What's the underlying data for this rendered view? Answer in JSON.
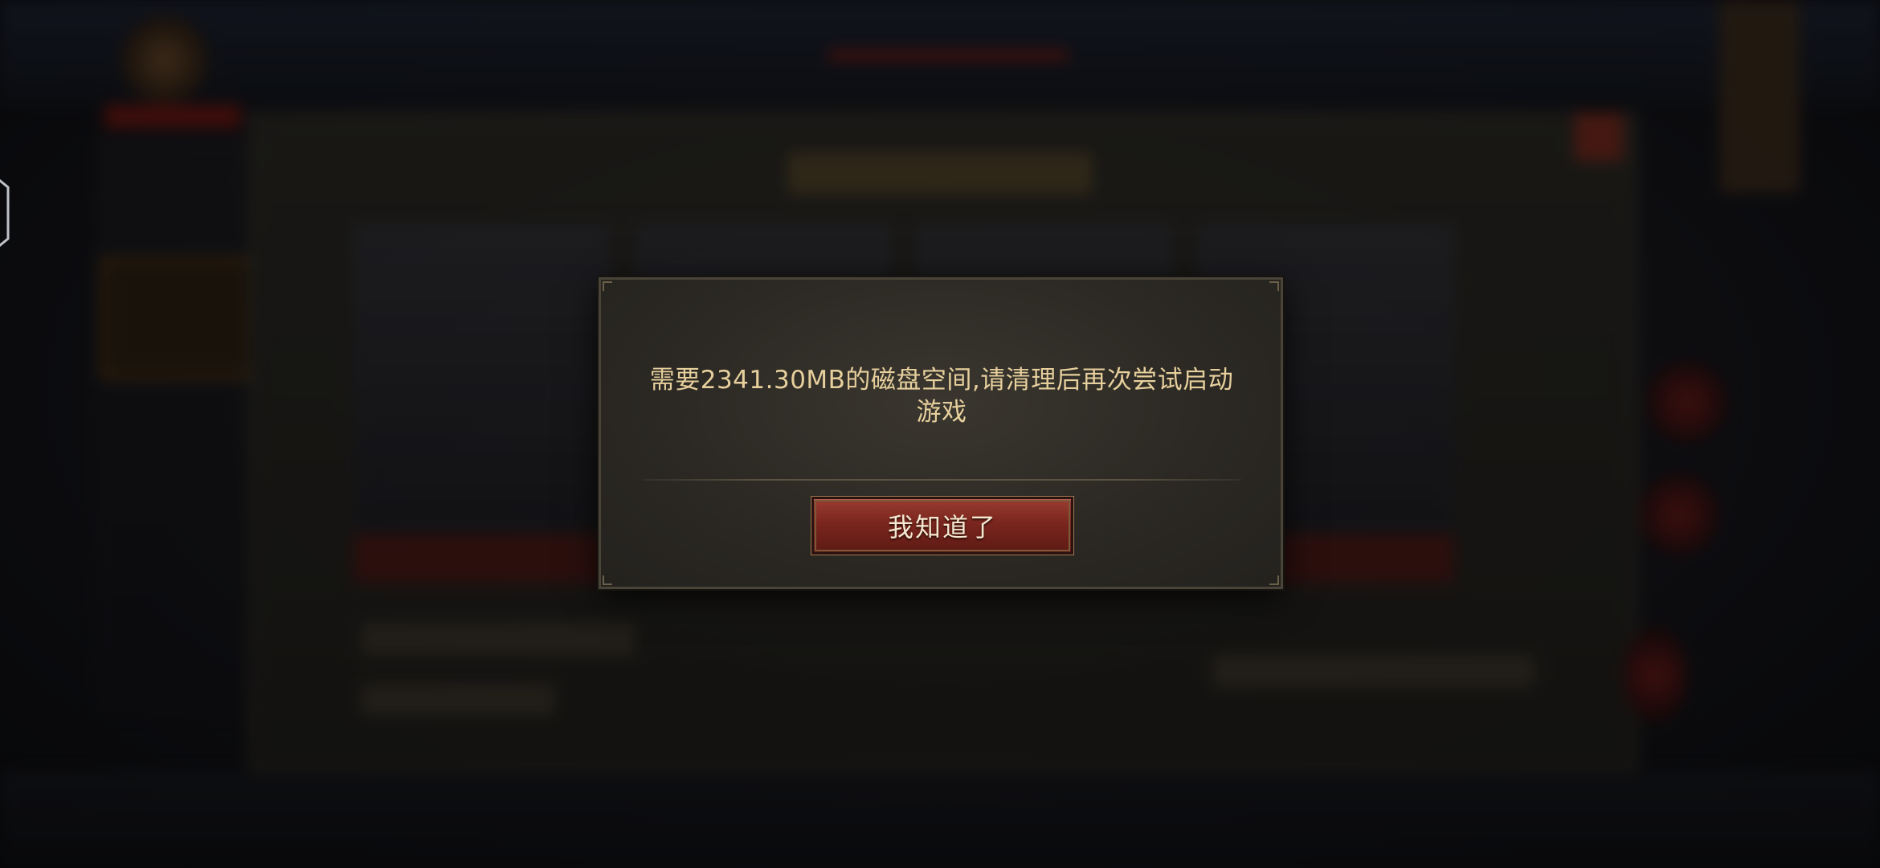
{
  "dialog": {
    "message": "需要2341.30MB的磁盘空间,请清理后再次尝试启动游戏",
    "confirm_label": "我知道了"
  },
  "colors": {
    "dialog_text": "#e6cf9c",
    "button_red": "#7a261e",
    "dialog_bg": "#2b2823"
  }
}
